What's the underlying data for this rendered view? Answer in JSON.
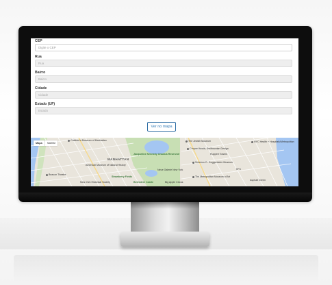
{
  "form": {
    "cep": {
      "label": "CEP",
      "placeholder": "Digite o CEP"
    },
    "rua": {
      "label": "Rua",
      "placeholder": "Rua"
    },
    "bairro": {
      "label": "Bairro",
      "placeholder": "Bairro"
    },
    "cidade": {
      "label": "Cidade",
      "placeholder": "Cidade"
    },
    "estado": {
      "label": "Estado (UF)",
      "placeholder": "Estado"
    },
    "submit_label": "Ver no mapa"
  },
  "map": {
    "type_options": [
      "Mapa",
      "Satélite"
    ],
    "selected_type": "Mapa",
    "labels": {
      "manhattan": "MANHATTAN",
      "childrens_museum": "Children's Museum of Manhattan",
      "jewish_museum": "The Jewish Museum",
      "cooper_hewitt": "Cooper Hewitt, Smithsonian Design",
      "nyc_health": "NYC Health + Hospitals/Metropolitan",
      "natural_history": "American Museum of Natural History",
      "reservoir": "Jacqueline Kennedy Onassis Reservoir",
      "solomon": "Solomon R. Guggenheim Museum",
      "neue_galerie": "Neue Galerie New York",
      "beacon": "Beacon Theatre",
      "historical_society": "New-York Historical Society",
      "strawberry_fields": "Strawberry Fields",
      "belvedere": "Belvedere Castle",
      "met": "The Metropolitan Museum of Art",
      "ruppert": "Ruppert Towers",
      "asphalt_green": "Asphalt Green",
      "kfc": "KFC",
      "big_apple": "Big Apple Circus"
    }
  }
}
